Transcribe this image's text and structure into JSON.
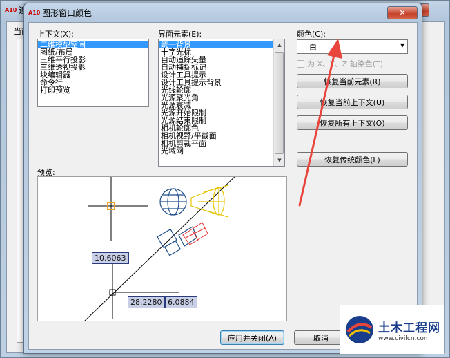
{
  "background_window": {
    "title_partial": "追",
    "label_partial": "当前",
    "app_icon": "A10"
  },
  "dialog": {
    "title": "图形窗口颜色",
    "app_icon": "A10",
    "close_glyph": "✕"
  },
  "context": {
    "label": "上下文(X):",
    "items": [
      "二维模型空间",
      "图纸/布局",
      "三维平行投影",
      "三维透视投影",
      "块编辑器",
      "命令行",
      "打印预览"
    ],
    "selected_index": 0
  },
  "interface_elements": {
    "label": "界面元素(E):",
    "items": [
      "统一背景",
      "十字光标",
      "自动追踪矢量",
      "自动捕捉标记",
      "设计工具提示",
      "设计工具提示背景",
      "光线轮廓",
      "光源聚光角",
      "光源衰减",
      "光源开始限制",
      "光源结束限制",
      "相机轮廓色",
      "相机视野/平截面",
      "相机剪裁平面",
      "光域网"
    ],
    "selected_index": 0
  },
  "color": {
    "label": "颜色(C):",
    "value": "白",
    "swatch": "#ffffff",
    "tint_label": "为 X、Y、Z 轴染色(T)",
    "tint_checked": false
  },
  "buttons": {
    "restore_element": "恢复当前元素(R)",
    "restore_context": "恢复当前上下文(U)",
    "restore_all": "恢复所有上下文(O)",
    "restore_classic": "恢复传统颜色(L)",
    "apply_close": "应用并关闭(A)",
    "cancel": "取消"
  },
  "preview": {
    "label": "预览:",
    "dims": [
      "10.6063",
      "28.2280",
      "6.0884"
    ]
  },
  "accent_colors": {
    "selection": "#3399ff",
    "arrow": "#e8463c",
    "snap_marker": "#f0a020",
    "light_yellow": "#e8c400",
    "glyph_blue": "#1f4f8a",
    "camera_red": "#e83030"
  },
  "watermark": {
    "name": "土木工程网",
    "url": "www.civilcn.com"
  }
}
